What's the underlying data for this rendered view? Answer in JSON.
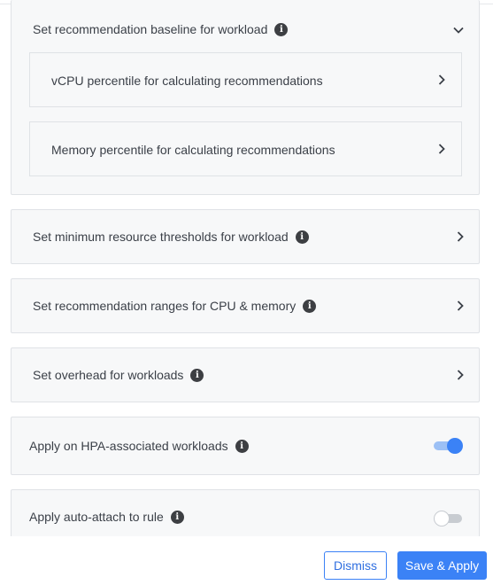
{
  "colors": {
    "accent": "#3b82f6",
    "panel_bg": "#f7f8f9",
    "panel_border": "#dfe2e6",
    "info_icon": "#3d3f43",
    "toggle_off_track": "#c8ccd1"
  },
  "sections": {
    "baseline": {
      "title": "Set recommendation baseline for workload",
      "expanded": true,
      "icon": "chevron-down-icon",
      "items": [
        {
          "label": "vCPU percentile for calculating recommendations",
          "icon": "chevron-right-icon"
        },
        {
          "label": "Memory percentile for calculating recommendations",
          "icon": "chevron-right-icon"
        }
      ]
    },
    "min_thresholds": {
      "title": "Set minimum resource thresholds for workload",
      "icon": "chevron-right-icon"
    },
    "ranges": {
      "title": "Set recommendation ranges for CPU & memory",
      "icon": "chevron-right-icon"
    },
    "overhead": {
      "title": "Set overhead for workloads",
      "icon": "chevron-right-icon"
    }
  },
  "toggles": {
    "hpa": {
      "label": "Apply on HPA-associated workloads",
      "enabled": true
    },
    "auto_attach": {
      "label": "Apply auto-attach to rule",
      "enabled": false
    }
  },
  "info_icon_glyph": "i",
  "footer": {
    "dismiss_label": "Dismiss",
    "save_label": "Save & Apply"
  }
}
